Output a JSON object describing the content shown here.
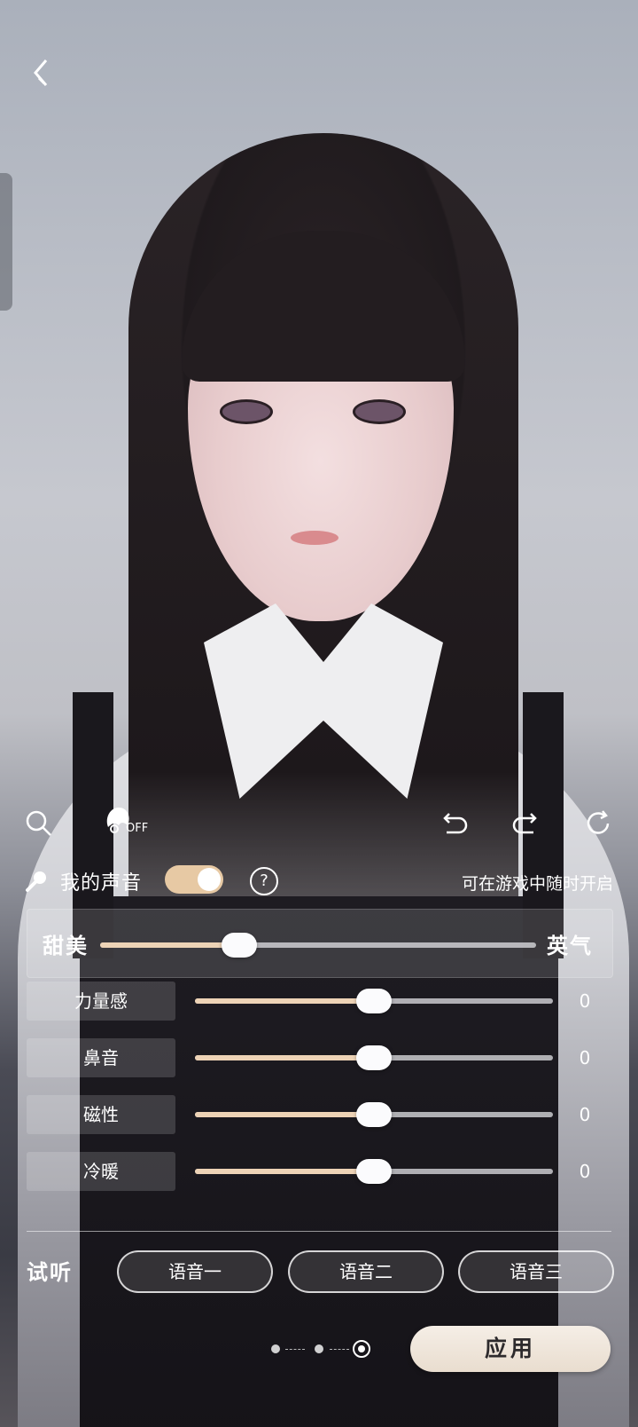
{
  "toolbar": {
    "left_icons": [
      "search-icon",
      "hair-toggle-icon"
    ],
    "hair_state": "OFF",
    "right_icons": [
      "undo-icon",
      "redo-icon",
      "reset-icon"
    ]
  },
  "voice_toggle": {
    "label": "我的声音",
    "enabled": true,
    "help_symbol": "?",
    "hint": "可在游戏中随时开启"
  },
  "main_slider": {
    "left_label": "甜美",
    "right_label": "英气",
    "value_fraction": 0.32
  },
  "params": [
    {
      "label": "力量感",
      "value": "0",
      "fraction": 0.5
    },
    {
      "label": "鼻音",
      "value": "0",
      "fraction": 0.5
    },
    {
      "label": "磁性",
      "value": "0",
      "fraction": 0.5
    },
    {
      "label": "冷暖",
      "value": "0",
      "fraction": 0.5
    }
  ],
  "preview": {
    "label": "试听",
    "buttons": [
      "语音一",
      "语音二",
      "语音三"
    ]
  },
  "pager": {
    "count": 3,
    "active_index": 2
  },
  "apply_label": "应用",
  "colors": {
    "accent": "#e7c9a4",
    "slider_fill": "#edd3b6"
  }
}
